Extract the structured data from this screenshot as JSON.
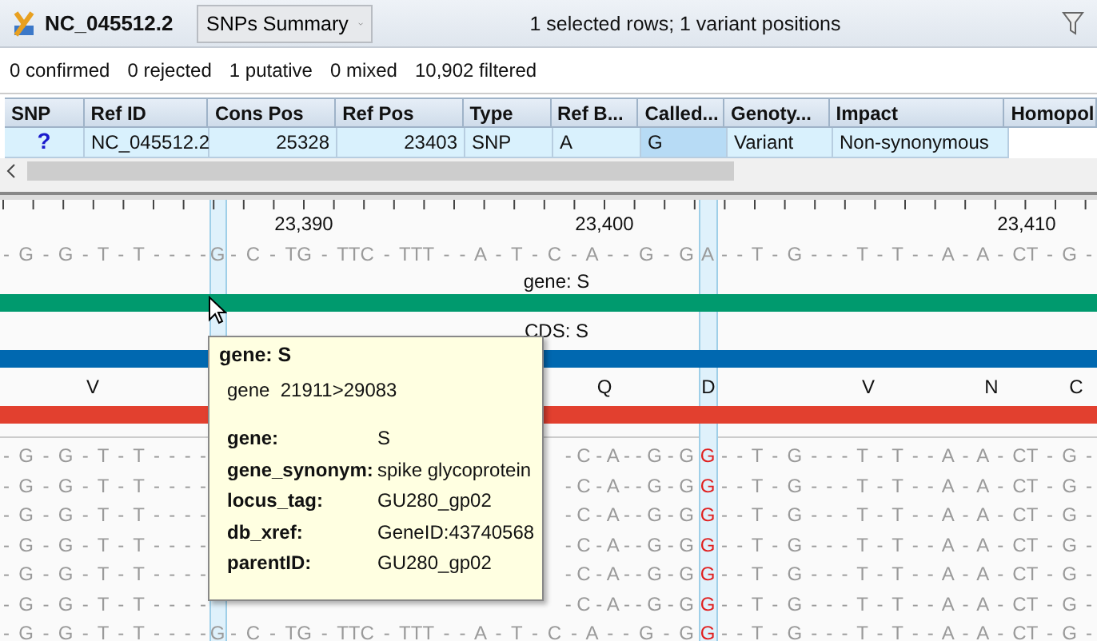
{
  "document": {
    "title": "NC_045512.2",
    "view_selector": "SNPs Summary",
    "selection_info": "1 selected rows; 1 variant positions"
  },
  "counts": [
    "0 confirmed",
    "0 rejected",
    "1 putative",
    "0 mixed",
    "10,902 filtered"
  ],
  "table": {
    "columns": [
      "SNP",
      "Ref ID",
      "Cons Pos",
      "Ref Pos",
      "Type",
      "Ref B...",
      "Called...",
      "Genoty...",
      "Impact",
      "Homopol"
    ],
    "rows": [
      {
        "selected": true,
        "cells": [
          {
            "text": "?",
            "selected": false
          },
          {
            "text": "NC_045512.2",
            "selected": false
          },
          {
            "text": "25328",
            "selected": false
          },
          {
            "text": "23403",
            "selected": false
          },
          {
            "text": "SNP",
            "selected": false
          },
          {
            "text": "A",
            "selected": false
          },
          {
            "text": "G",
            "selected": true
          },
          {
            "text": "Variant",
            "selected": false
          },
          {
            "text": "Non-synonymous",
            "selected": false
          }
        ]
      }
    ]
  },
  "viewer": {
    "ruler": [
      "23,390",
      "23,400",
      "23,410"
    ],
    "consensus": {
      "left": "- G - G - T - T - - - -",
      "first": "G",
      "middle": "- C - TG - TTC - TTT - - A - T - C - A - - G - G",
      "variant": "A",
      "right": "- - T - G - - - T - T - - A - A - CT - G -"
    },
    "annotations": [
      {
        "kind": "gene",
        "label": "gene: S",
        "color": "#009a6e"
      },
      {
        "kind": "cds",
        "label": "CDS: S",
        "color": "#0068b0"
      }
    ],
    "translation": {
      "residues": [
        "V",
        "Q",
        "D",
        "V",
        "N",
        "C"
      ],
      "color": "#e2402f"
    },
    "reads": [
      {
        "left": "- G - G - T - T - - - -",
        "middle": "- C - A - - G - G",
        "variant": "G",
        "right": "- - T - G - - - T - T - - A - A - CT - G -"
      },
      {
        "left": "- G - G - T - T - - - -",
        "middle": "- C - A - - G - G",
        "variant": "G",
        "right": "- - T - G - - - T - T - - A - A - CT - G -"
      },
      {
        "left": "- G - G - T - T - - - -",
        "middle": "- C - A - - G - G",
        "variant": "G",
        "right": "- - T - G - - - T - T - - A - A - CT - G -"
      },
      {
        "left": "- G - G - T - T - - - -",
        "middle": "- C - A - - G - G",
        "variant": "G",
        "right": "- - T - G - - - T - T - - A - A - CT - G -"
      },
      {
        "left": "- G - G - T - T - - - -",
        "middle": "- C - A - - G - G",
        "variant": "G",
        "right": "- - T - G - - - T - T - - A - A - CT - G -"
      },
      {
        "left": "- G - G - T - T - - - -",
        "middle": "- C - A - - G - G",
        "variant": "G",
        "right": "- - T - G - - - T - T - - A - A - CT - G -"
      },
      {
        "left": "- G - G - T - T - - - -",
        "first": "G",
        "middle": "- C - TG - TTC - TTT - - A - T - C - A - - G - G",
        "variant": "G",
        "right": "- - T - G - - - T - T - - A - A - CT - G -"
      }
    ],
    "tooltip": {
      "title": "gene: S",
      "summary": "gene  21911>29083",
      "fields": [
        {
          "key": "gene:",
          "value": "S"
        },
        {
          "key": "gene_synonym:",
          "value": "spike glycoprotein"
        },
        {
          "key": "locus_tag:",
          "value": "GU280_gp02"
        },
        {
          "key": "db_xref:",
          "value": "GeneID:43740568"
        },
        {
          "key": "parentID:",
          "value": "GU280_gp02"
        }
      ]
    }
  }
}
